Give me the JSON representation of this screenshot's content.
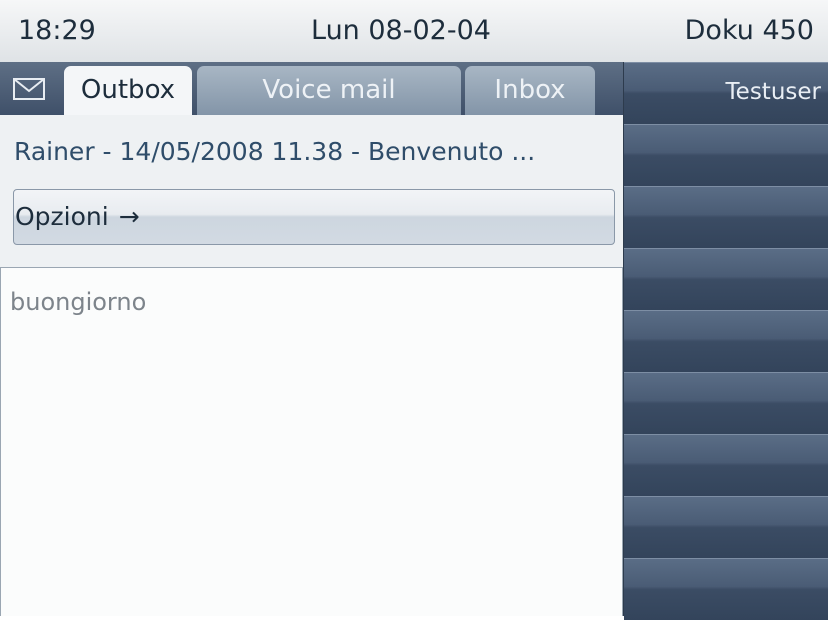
{
  "status_bar": {
    "time": "18:29",
    "date": "Lun 08-02-04",
    "device": "Doku 450"
  },
  "tabs": [
    {
      "label": "Outbox",
      "active": true
    },
    {
      "label": "Voice mail",
      "active": false
    },
    {
      "label": "Inbox",
      "active": false
    }
  ],
  "message": {
    "header": "Rainer - 14/05/2008 11.38 - Benvenuto ...",
    "body": "buongiorno"
  },
  "options_button": {
    "label": "Opzioni",
    "arrow": "→"
  },
  "sidebar": {
    "user": "Testuser",
    "slot_count": 9
  },
  "icons": {
    "mail": "mail-icon",
    "arrow": "arrow-right-icon"
  },
  "colors": {
    "header_text": "#2f4d6a",
    "sidebar": "#3d4f66",
    "tab_active": "#f4f6f8"
  }
}
